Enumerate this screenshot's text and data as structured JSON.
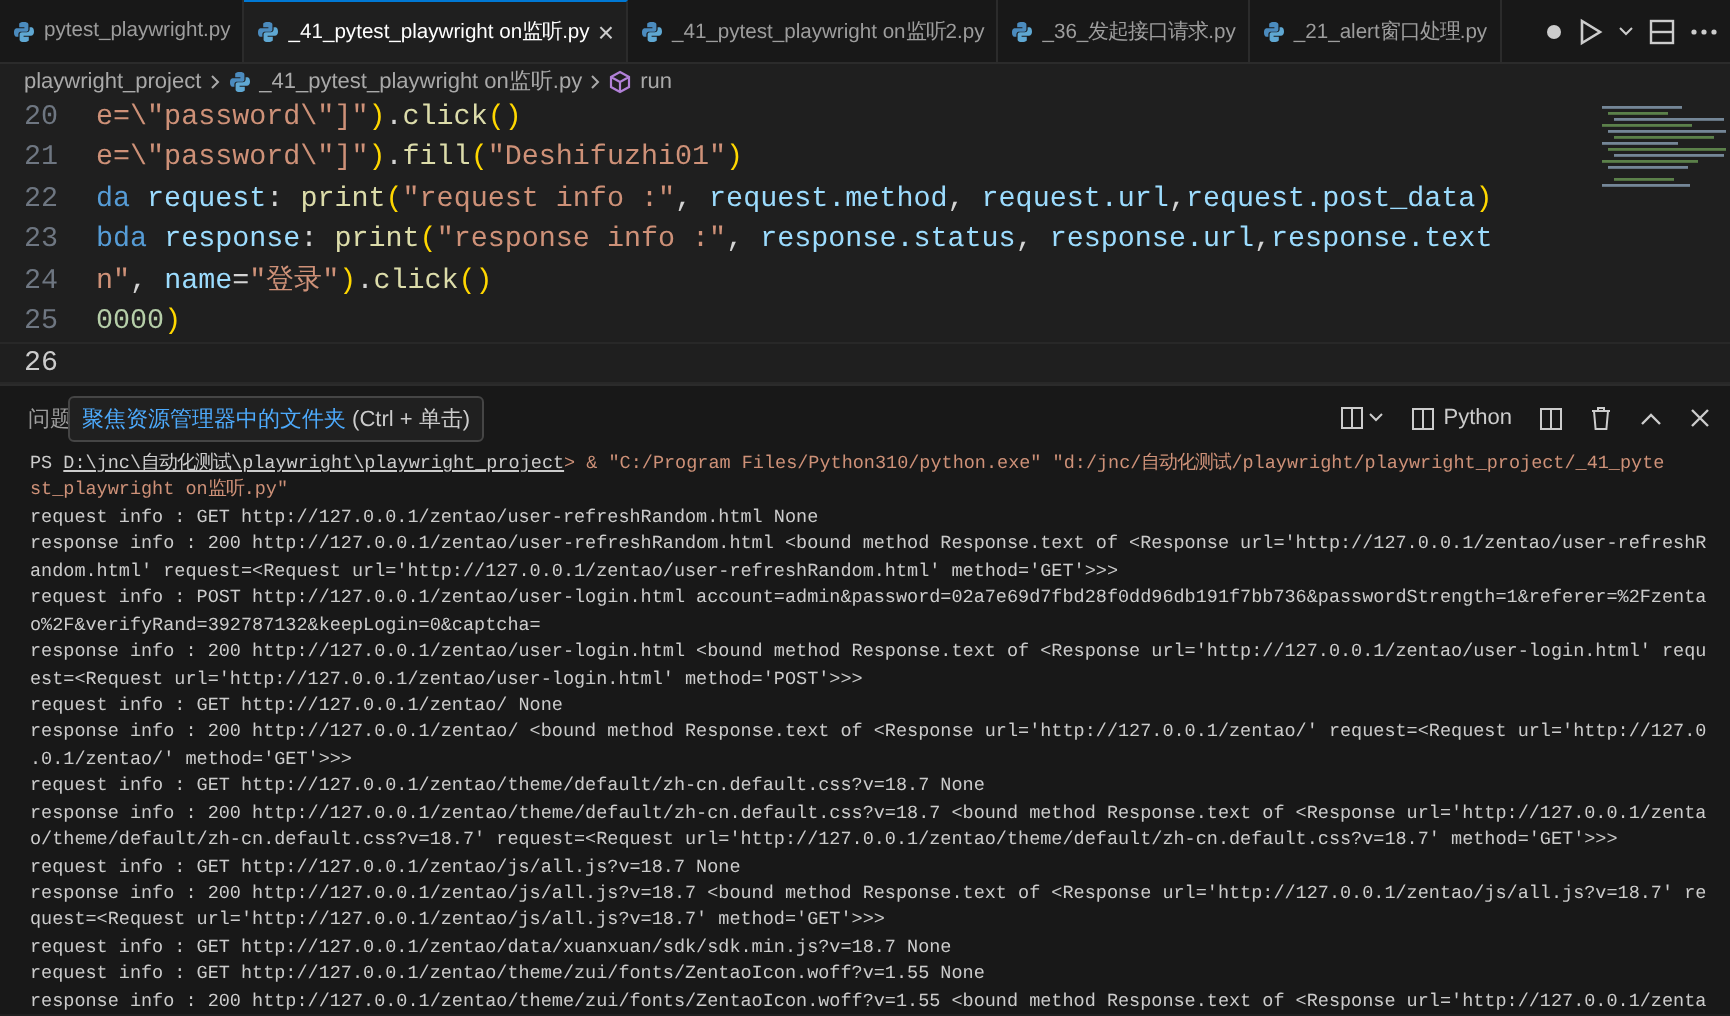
{
  "tabs": [
    {
      "label": "pytest_playwright.py",
      "selected": false
    },
    {
      "label": "_41_pytest_playwright on监听.py",
      "selected": true,
      "close": "×"
    },
    {
      "label": "_41_pytest_playwright on监听2.py",
      "selected": false
    },
    {
      "label": "_36_发起接口请求.py",
      "selected": false
    },
    {
      "label": "_21_alert窗口处理.py",
      "selected": false
    }
  ],
  "breadcrumb": [
    "playwright_project",
    "_41_pytest_playwright on监听.py",
    "run"
  ],
  "editor": {
    "lines": [
      {
        "number": "20",
        "tokens": [
          {
            "kind": "str",
            "text": "e=\\\"password\\\"]\""
          },
          {
            "kind": "paren",
            "text": ")"
          },
          {
            "kind": "plain",
            "text": "."
          },
          {
            "kind": "fn",
            "text": "click"
          },
          {
            "kind": "paren",
            "text": "()"
          }
        ]
      },
      {
        "number": "21",
        "tokens": [
          {
            "kind": "str",
            "text": "e=\\\"password\\\"]\""
          },
          {
            "kind": "paren",
            "text": ")"
          },
          {
            "kind": "plain",
            "text": "."
          },
          {
            "kind": "fn",
            "text": "fill"
          },
          {
            "kind": "paren",
            "text": "("
          },
          {
            "kind": "str",
            "text": "\"Deshifuzhi01\""
          },
          {
            "kind": "paren",
            "text": ")"
          }
        ]
      },
      {
        "number": "22",
        "tokens": [
          {
            "kind": "kw",
            "text": "da "
          },
          {
            "kind": "var",
            "text": "request"
          },
          {
            "kind": "plain",
            "text": ": "
          },
          {
            "kind": "fn",
            "text": "print"
          },
          {
            "kind": "paren",
            "text": "("
          },
          {
            "kind": "str",
            "text": "\"request info :\""
          },
          {
            "kind": "plain",
            "text": ", "
          },
          {
            "kind": "var",
            "text": "request.method"
          },
          {
            "kind": "plain",
            "text": ", "
          },
          {
            "kind": "var",
            "text": "request.url"
          },
          {
            "kind": "plain",
            "text": ","
          },
          {
            "kind": "var",
            "text": "request.post_data"
          },
          {
            "kind": "paren",
            "text": ")"
          }
        ]
      },
      {
        "number": "23",
        "tokens": [
          {
            "kind": "kw",
            "text": "bda "
          },
          {
            "kind": "var",
            "text": "response"
          },
          {
            "kind": "plain",
            "text": ": "
          },
          {
            "kind": "fn",
            "text": "print"
          },
          {
            "kind": "paren",
            "text": "("
          },
          {
            "kind": "str",
            "text": "\"response info :\""
          },
          {
            "kind": "plain",
            "text": ", "
          },
          {
            "kind": "var",
            "text": "response.status"
          },
          {
            "kind": "plain",
            "text": ", "
          },
          {
            "kind": "var",
            "text": "response.url"
          },
          {
            "kind": "plain",
            "text": ","
          },
          {
            "kind": "var",
            "text": "response.text"
          }
        ]
      },
      {
        "number": "24",
        "tokens": [
          {
            "kind": "str",
            "text": "n\""
          },
          {
            "kind": "plain",
            "text": ", "
          },
          {
            "kind": "var",
            "text": "name"
          },
          {
            "kind": "plain",
            "text": "="
          },
          {
            "kind": "str",
            "text": "\"登录\""
          },
          {
            "kind": "paren",
            "text": ")"
          },
          {
            "kind": "plain",
            "text": "."
          },
          {
            "kind": "fn",
            "text": "click"
          },
          {
            "kind": "paren",
            "text": "()"
          }
        ]
      },
      {
        "number": "25",
        "tokens": [
          {
            "kind": "num",
            "text": "0000"
          },
          {
            "kind": "paren",
            "text": ")"
          }
        ]
      },
      {
        "number": "26",
        "current": true
      }
    ]
  },
  "panel": {
    "tab": "问题",
    "tooltip": "聚焦资源管理器中的文件夹 (Ctrl + 单击)",
    "terminal_name": "Python"
  },
  "terminal": {
    "prompt_prefix": "PS ",
    "prompt_path": "D:\\jnc\\自动化测试\\playwright\\playwright_project",
    "command": "> & \"C:/Program Files/Python310/python.exe\" \"d:/jnc/自动化测试/playwright/playwright_project/_41_pyte",
    "lines": [
      "st_playwright on监听.py\"",
      "request info : GET http://127.0.0.1/zentao/user-refreshRandom.html None",
      "response info : 200 http://127.0.0.1/zentao/user-refreshRandom.html <bound method Response.text of <Response url='http://127.0.0.1/zentao/user-refreshR",
      "andom.html' request=<Request url='http://127.0.0.1/zentao/user-refreshRandom.html' method='GET'>>>",
      "request info : POST http://127.0.0.1/zentao/user-login.html account=admin&password=02a7e69d7fbd28f0dd96db191f7bb736&passwordStrength=1&referer=%2Fzenta",
      "o%2F&verifyRand=392787132&keepLogin=0&captcha=",
      "response info : 200 http://127.0.0.1/zentao/user-login.html <bound method Response.text of <Response url='http://127.0.0.1/zentao/user-login.html' requ",
      "est=<Request url='http://127.0.0.1/zentao/user-login.html' method='POST'>>>",
      "request info : GET http://127.0.0.1/zentao/ None",
      "response info : 200 http://127.0.0.1/zentao/ <bound method Response.text of <Response url='http://127.0.0.1/zentao/' request=<Request url='http://127.0",
      ".0.1/zentao/' method='GET'>>>",
      "request info : GET http://127.0.0.1/zentao/theme/default/zh-cn.default.css?v=18.7 None",
      "response info : 200 http://127.0.0.1/zentao/theme/default/zh-cn.default.css?v=18.7 <bound method Response.text of <Response url='http://127.0.0.1/zenta",
      "o/theme/default/zh-cn.default.css?v=18.7' request=<Request url='http://127.0.0.1/zentao/theme/default/zh-cn.default.css?v=18.7' method='GET'>>>",
      "request info : GET http://127.0.0.1/zentao/js/all.js?v=18.7 None",
      "response info : 200 http://127.0.0.1/zentao/js/all.js?v=18.7 <bound method Response.text of <Response url='http://127.0.0.1/zentao/js/all.js?v=18.7' re",
      "quest=<Request url='http://127.0.0.1/zentao/js/all.js?v=18.7' method='GET'>>>",
      "request info : GET http://127.0.0.1/zentao/data/xuanxuan/sdk/sdk.min.js?v=18.7 None",
      "request info : GET http://127.0.0.1/zentao/theme/zui/fonts/ZentaoIcon.woff?v=1.55 None",
      "response info : 200 http://127.0.0.1/zentao/theme/zui/fonts/ZentaoIcon.woff?v=1.55 <bound method Response.text of <Response url='http://127.0.0.1/zenta"
    ]
  }
}
